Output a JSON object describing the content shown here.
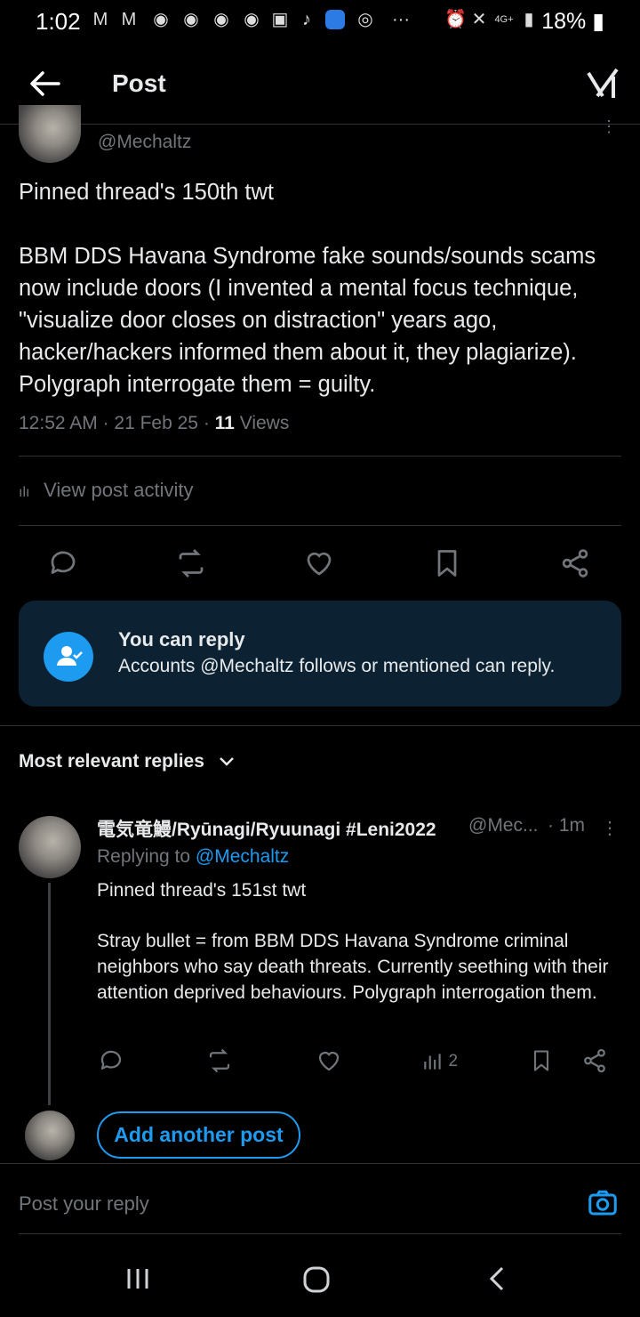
{
  "status_bar": {
    "time": "1:02",
    "battery": "18%"
  },
  "header": {
    "title": "Post"
  },
  "main_post": {
    "author_handle": "@Mechaltz",
    "text_line1": "Pinned thread's 150th twt",
    "text_body": "BBM DDS Havana Syndrome fake sounds/sounds scams now include doors (I invented a mental focus technique, \"visualize door closes on distraction\" years ago, hacker/hackers informed them about it, they plagiarize). Polygraph interrogate them = guilty.",
    "time": "12:52 AM",
    "date": "21 Feb 25",
    "views_count": "11",
    "views_label": "Views",
    "activity_label": "View post activity"
  },
  "reply_card": {
    "title": "You can reply",
    "subtitle": "Accounts @Mechaltz follows or mentioned can reply."
  },
  "replies_header": {
    "label": "Most relevant replies"
  },
  "reply": {
    "author_name": "電気竜鰻/Ryūnagi/Ryuunagi #Leni2022",
    "author_handle": "@Mec...",
    "time": "· 1m",
    "replying_prefix": "Replying to",
    "replying_handle": "@Mechaltz",
    "text_line1": "Pinned thread's 151st twt",
    "text_body": "Stray bullet = from BBM DDS Havana Syndrome criminal neighbors who say death threats. Currently seething with their attention deprived behaviours. Polygraph interrogation them.",
    "views_count": "2"
  },
  "add_post": {
    "label": "Add another post"
  },
  "composer": {
    "placeholder": "Post your reply"
  },
  "colors": {
    "accent": "#1d9bf0",
    "muted": "#71767b",
    "card_bg": "#0c2233"
  }
}
